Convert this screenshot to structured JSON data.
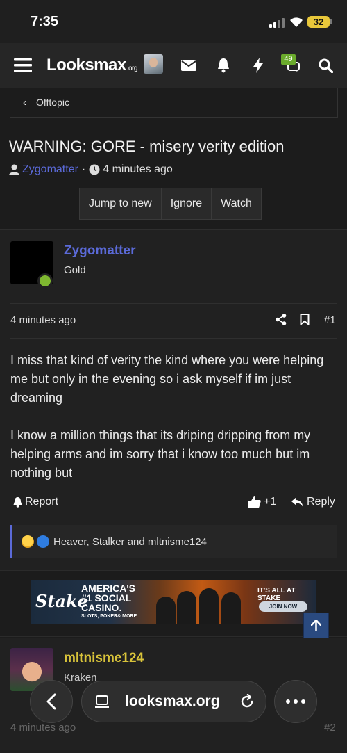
{
  "status_bar": {
    "time": "7:35",
    "battery": "32"
  },
  "nav": {
    "logo_main": "Looksmax",
    "logo_suffix": ".org",
    "notifications_badge": "49"
  },
  "breadcrumb": {
    "label": "Offtopic"
  },
  "thread": {
    "title": "WARNING: GORE - misery verity edition",
    "author": "Zygomatter",
    "separator": "·",
    "time": "4 minutes ago",
    "buttons": [
      "Jump to new",
      "Ignore",
      "Watch"
    ]
  },
  "post1": {
    "username": "Zygomatter",
    "rank": "Gold",
    "time": "4 minutes ago",
    "number": "#1",
    "paragraphs": [
      "I miss that kind of verity the kind where you were helping me but only in the evening so i ask myself if im just dreaming",
      "I know a million things that its driping dripping from my helping arms and im sorry that i know too much but im nothing but"
    ],
    "report_label": "Report",
    "like_count": "+1",
    "reply_label": "Reply",
    "reactions_text": "Heaver, Stalker and mltnisme124"
  },
  "ad": {
    "brand": "Stake",
    "headline_1": "AMERICA'S",
    "headline_2": "#1 SOCIAL",
    "headline_3": "CASINO.",
    "sub": "SLOTS, POKER& MORE",
    "right_text": "IT'S ALL AT STAKE",
    "cta": "JOIN NOW"
  },
  "post2": {
    "username": "mltnisme124",
    "rank": "Kraken",
    "time": "4 minutes ago",
    "number": "#2"
  },
  "browser": {
    "url": "looksmax.org"
  },
  "colors": {
    "link": "#5b6ad8",
    "online": "#7fb830",
    "username2": "#d8c33a",
    "badge": "#6bab2c"
  }
}
